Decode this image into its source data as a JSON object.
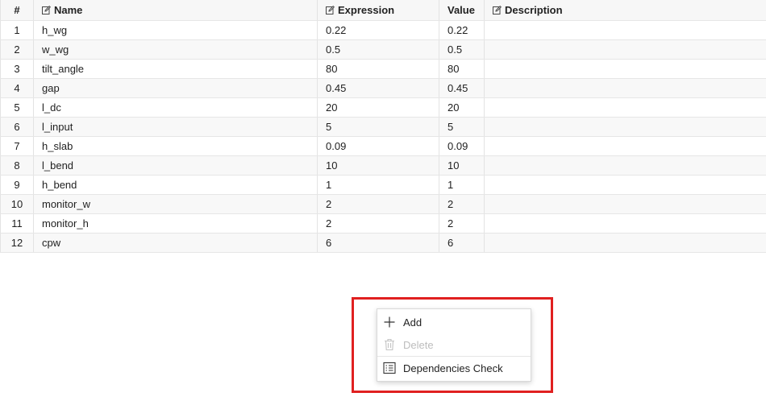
{
  "table": {
    "headers": {
      "index": "#",
      "name": "Name",
      "expression": "Expression",
      "value": "Value",
      "description": "Description"
    },
    "rows": [
      {
        "index": "1",
        "name": "h_wg",
        "expression": "0.22",
        "value": "0.22",
        "description": ""
      },
      {
        "index": "2",
        "name": "w_wg",
        "expression": "0.5",
        "value": "0.5",
        "description": ""
      },
      {
        "index": "3",
        "name": "tilt_angle",
        "expression": "80",
        "value": "80",
        "description": ""
      },
      {
        "index": "4",
        "name": "gap",
        "expression": "0.45",
        "value": "0.45",
        "description": ""
      },
      {
        "index": "5",
        "name": "l_dc",
        "expression": "20",
        "value": "20",
        "description": ""
      },
      {
        "index": "6",
        "name": "l_input",
        "expression": "5",
        "value": "5",
        "description": ""
      },
      {
        "index": "7",
        "name": "h_slab",
        "expression": "0.09",
        "value": "0.09",
        "description": ""
      },
      {
        "index": "8",
        "name": "l_bend",
        "expression": "10",
        "value": "10",
        "description": ""
      },
      {
        "index": "9",
        "name": "h_bend",
        "expression": "1",
        "value": "1",
        "description": ""
      },
      {
        "index": "10",
        "name": "monitor_w",
        "expression": "2",
        "value": "2",
        "description": ""
      },
      {
        "index": "11",
        "name": "monitor_h",
        "expression": "2",
        "value": "2",
        "description": ""
      },
      {
        "index": "12",
        "name": "cpw",
        "expression": "6",
        "value": "6",
        "description": ""
      }
    ]
  },
  "context_menu": {
    "items": [
      {
        "label": "Add",
        "icon": "plus-icon",
        "enabled": true
      },
      {
        "label": "Delete",
        "icon": "trash-icon",
        "enabled": false
      },
      {
        "label": "Dependencies Check",
        "icon": "checklist-icon",
        "enabled": true
      }
    ]
  },
  "colors": {
    "highlight_border": "#e02020",
    "disabled_text": "#bdbdbd"
  }
}
